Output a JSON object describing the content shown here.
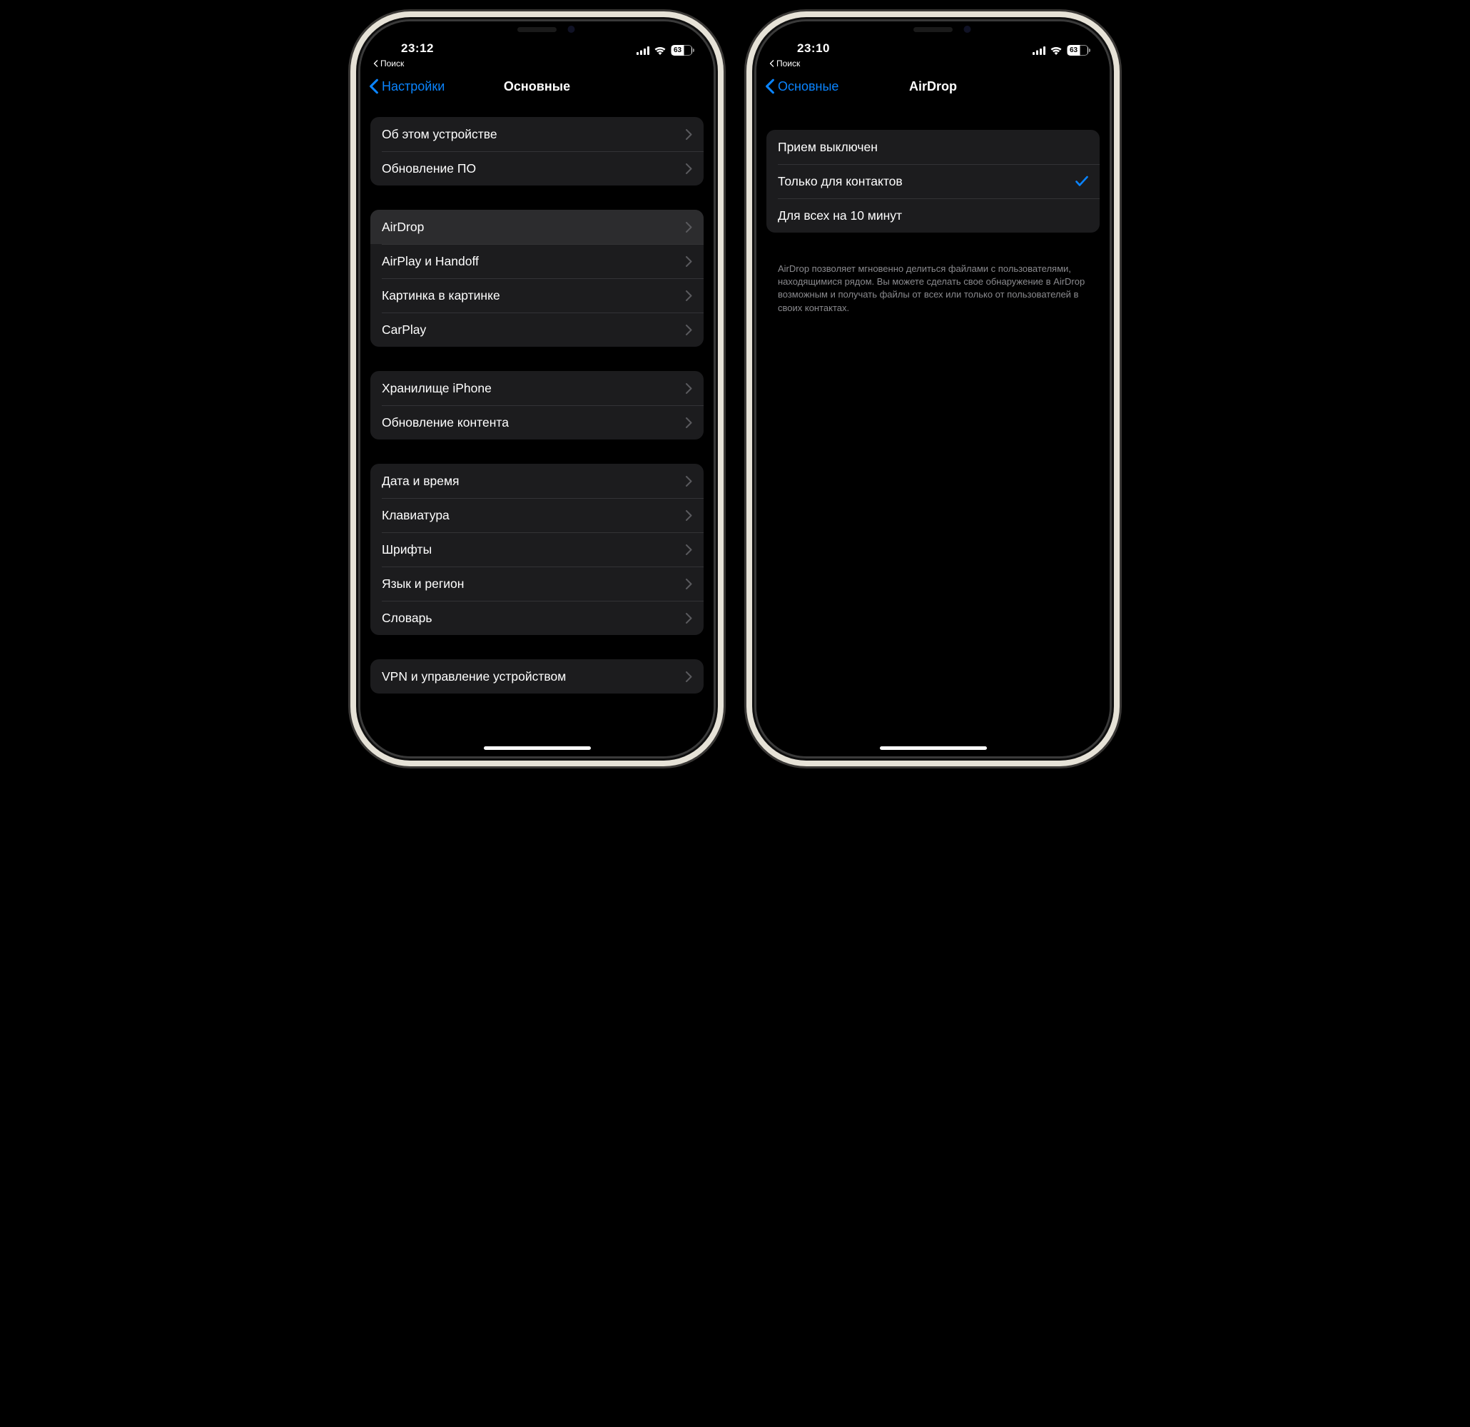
{
  "left": {
    "status": {
      "time": "23:12",
      "battery": "63"
    },
    "breadcrumb": "Поиск",
    "nav": {
      "back": "Настройки",
      "title": "Основные"
    },
    "groups": [
      {
        "rows": [
          {
            "label": "Об этом устройстве"
          },
          {
            "label": "Обновление ПО"
          }
        ]
      },
      {
        "rows": [
          {
            "label": "AirDrop",
            "highlight": true
          },
          {
            "label": "AirPlay и Handoff"
          },
          {
            "label": "Картинка в картинке"
          },
          {
            "label": "CarPlay"
          }
        ]
      },
      {
        "rows": [
          {
            "label": "Хранилище iPhone"
          },
          {
            "label": "Обновление контента"
          }
        ]
      },
      {
        "rows": [
          {
            "label": "Дата и время"
          },
          {
            "label": "Клавиатура"
          },
          {
            "label": "Шрифты"
          },
          {
            "label": "Язык и регион"
          },
          {
            "label": "Словарь"
          }
        ]
      },
      {
        "rows": [
          {
            "label": "VPN и управление устройством"
          }
        ]
      }
    ]
  },
  "right": {
    "status": {
      "time": "23:10",
      "battery": "63"
    },
    "breadcrumb": "Поиск",
    "nav": {
      "back": "Основные",
      "title": "AirDrop"
    },
    "options": [
      {
        "label": "Прием выключен",
        "selected": false
      },
      {
        "label": "Только для контактов",
        "selected": true
      },
      {
        "label": "Для всех на 10 минут",
        "selected": false
      }
    ],
    "footer": "AirDrop позволяет мгновенно делиться файлами с пользователями, находящимися рядом. Вы можете сделать свое обнаружение в AirDrop возможным и получать файлы от всех или только от пользователей в своих контактах."
  }
}
